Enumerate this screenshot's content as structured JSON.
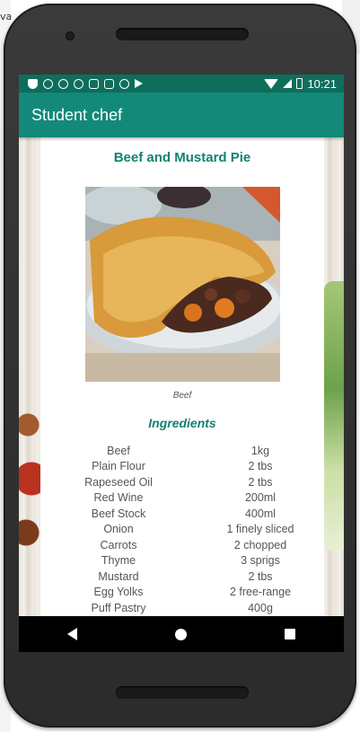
{
  "host": {
    "left_text": "va"
  },
  "status_bar": {
    "time": "10:21",
    "left_icons": [
      "shield-icon",
      "instagram-icon",
      "instagram-icon",
      "instagram-icon",
      "gmail-icon",
      "sd-card-icon",
      "circle-icon",
      "play-store-icon"
    ]
  },
  "app_bar": {
    "title": "Student chef"
  },
  "recipe": {
    "title": "Beef and Mustard Pie",
    "image_caption": "Beef",
    "ingredients_heading": "Ingredients",
    "ingredients": [
      {
        "name": "Beef",
        "quantity": "1kg"
      },
      {
        "name": "Plain Flour",
        "quantity": "2 tbs"
      },
      {
        "name": "Rapeseed Oil",
        "quantity": "2 tbs"
      },
      {
        "name": "Red Wine",
        "quantity": "200ml"
      },
      {
        "name": "Beef Stock",
        "quantity": "400ml"
      },
      {
        "name": "Onion",
        "quantity": "1 finely sliced"
      },
      {
        "name": "Carrots",
        "quantity": "2 chopped"
      },
      {
        "name": "Thyme",
        "quantity": "3 sprigs"
      },
      {
        "name": "Mustard",
        "quantity": "2 tbs"
      },
      {
        "name": "Egg Yolks",
        "quantity": "2 free-range"
      },
      {
        "name": "Puff Pastry",
        "quantity": "400g"
      }
    ]
  },
  "colors": {
    "status_bar": "#0e6e5c",
    "app_bar": "#13897a",
    "accent_text": "#128270"
  }
}
